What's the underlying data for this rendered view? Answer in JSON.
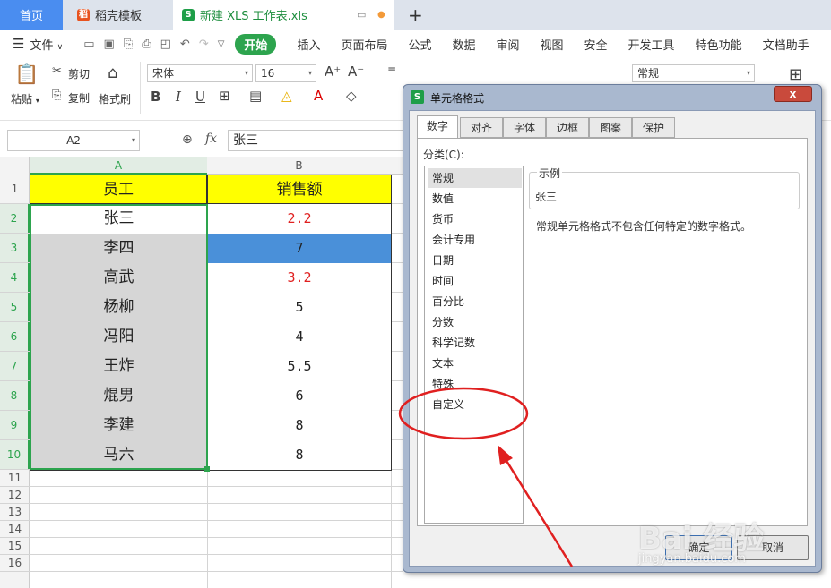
{
  "tabs": {
    "home": "首页",
    "docer": "稻壳模板",
    "file": "新建 XLS 工作表.xls",
    "file_icon": "S",
    "add": "+"
  },
  "menu": {
    "file": "文件",
    "items": [
      "开始",
      "插入",
      "页面布局",
      "公式",
      "数据",
      "审阅",
      "视图",
      "安全",
      "开发工具",
      "特色功能",
      "文档助手"
    ]
  },
  "ribbon": {
    "paste": "粘贴",
    "cut": "剪切",
    "copy": "复制",
    "format_painter": "格式刷",
    "font_name": "宋体",
    "font_size": "16",
    "number_format": "常规",
    "bold": "B",
    "italic": "I",
    "underline": "U"
  },
  "formula_bar": {
    "cell_ref": "A2",
    "fx": "fx",
    "value": "张三"
  },
  "sheet": {
    "col_headers": [
      "A",
      "B"
    ],
    "row_numbers": [
      "1",
      "2",
      "3",
      "4",
      "5",
      "6",
      "7",
      "8",
      "9",
      "10",
      "11",
      "12",
      "13",
      "14",
      "15",
      "16"
    ],
    "header": {
      "a": "员工",
      "b": "销售额"
    },
    "rows": [
      {
        "a": "张三",
        "b": "2.2",
        "b_color": "#e02020"
      },
      {
        "a": "李四",
        "b": "7",
        "b_color": "#222222"
      },
      {
        "a": "高武",
        "b": "3.2",
        "b_color": "#e02020"
      },
      {
        "a": "杨柳",
        "b": "5",
        "b_color": "#222222"
      },
      {
        "a": "冯阳",
        "b": "4",
        "b_color": "#222222"
      },
      {
        "a": "王炸",
        "b": "5.5",
        "b_color": "#222222"
      },
      {
        "a": "焜男",
        "b": "6",
        "b_color": "#222222"
      },
      {
        "a": "李建",
        "b": "8",
        "b_color": "#222222"
      },
      {
        "a": "马六",
        "b": "8",
        "b_color": "#222222"
      }
    ]
  },
  "dialog": {
    "title": "单元格格式",
    "icon": "S",
    "close": "x",
    "tabs": [
      "数字",
      "对齐",
      "字体",
      "边框",
      "图案",
      "保护"
    ],
    "category_label": "分类(C):",
    "categories": [
      "常规",
      "数值",
      "货币",
      "会计专用",
      "日期",
      "时间",
      "百分比",
      "分数",
      "科学记数",
      "文本",
      "特殊",
      "自定义"
    ],
    "sample_label": "示例",
    "sample_value": "张三",
    "description": "常规单元格格式不包含任何特定的数字格式。",
    "ok": "确定",
    "cancel": "取消"
  },
  "watermark": {
    "text": "Bai 经验",
    "url": "jingyan.baidu.com"
  },
  "colors": {
    "header_fill": "#ffff00",
    "selected_fill": "#d6d6d6",
    "highlight_fill": "#4a90d9",
    "accent_green": "#2da44e",
    "annotation_red": "#e02020"
  }
}
